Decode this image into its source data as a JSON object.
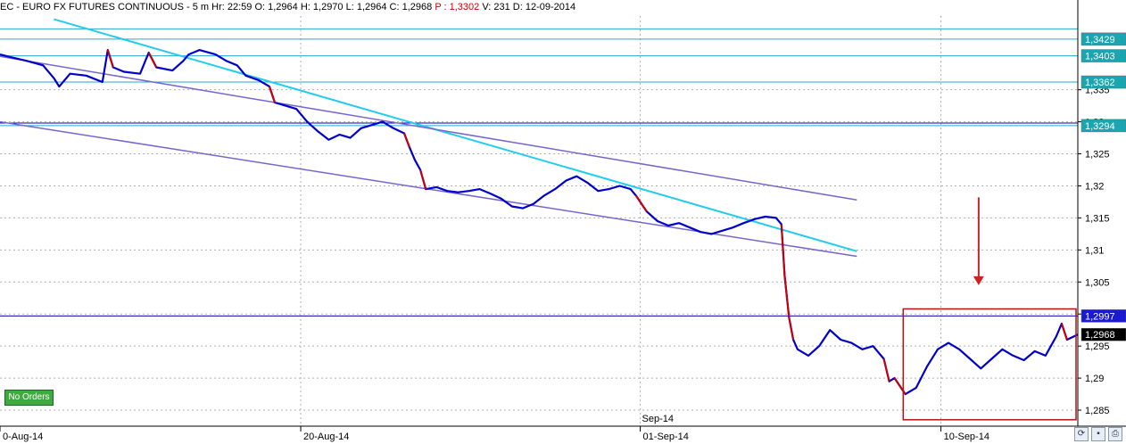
{
  "header": {
    "symbol": "EC - EURO FX FUTURES CONTINUOUS",
    "interval": "5 m",
    "hr": "Hr: 22:59",
    "open": "O: 1,2964",
    "high": "H: 1,2970",
    "low": "L: 1,2964",
    "close": "C: 1,2968",
    "p": "P : 1,3302",
    "volume": "V: 231",
    "date": "D: 12-09-2014"
  },
  "no_orders_label": "No Orders",
  "colors": {
    "price": "#0000cc",
    "price_down": "#cc0000",
    "trendline": "#22ccee",
    "channel": "#7766cc",
    "resistance_cyan": "#22aacc",
    "support_blue": "#0000bb",
    "box": "#bb1111",
    "arrow": "#cc2222",
    "grid": "#b0b0b0",
    "label_teal": "#1aa5b0",
    "label_blue": "#1a1ad0",
    "label_black": "#000000"
  },
  "chart_data": {
    "type": "line",
    "y_ticks": [
      "1,335",
      "1,33",
      "1,325",
      "1,32",
      "1,315",
      "1,31",
      "1,305",
      "1,3",
      "1,295",
      "1,29",
      "1,285"
    ],
    "x_ticks": [
      "0-Aug-14",
      "20-Aug-14",
      "01-Sep-14",
      "10-Sep-14"
    ],
    "x_marker": "Sep-14",
    "ylim": [
      1.2825,
      1.3465
    ],
    "price_labels": [
      {
        "text": "1,3429",
        "value": 1.3429,
        "kind": "teal"
      },
      {
        "text": "1,3403",
        "value": 1.3403,
        "kind": "teal"
      },
      {
        "text": "1,3362",
        "value": 1.3362,
        "kind": "teal"
      },
      {
        "text": "1,3294",
        "value": 1.3294,
        "kind": "teal"
      },
      {
        "text": "1,2997",
        "value": 1.2997,
        "kind": "blue"
      },
      {
        "text": "1,2968",
        "value": 1.2968,
        "kind": "black"
      }
    ],
    "series": [
      {
        "points": [
          [
            0,
            1.3405
          ],
          [
            0.012,
            1.34
          ],
          [
            0.025,
            1.3395
          ],
          [
            0.04,
            1.3388
          ],
          [
            0.05,
            1.3368
          ],
          [
            0.055,
            1.3355
          ],
          [
            0.065,
            1.3375
          ],
          [
            0.08,
            1.3372
          ],
          [
            0.095,
            1.3362
          ],
          [
            0.1,
            1.3412
          ],
          [
            0.105,
            1.3385
          ],
          [
            0.115,
            1.3378
          ],
          [
            0.13,
            1.3375
          ],
          [
            0.138,
            1.3408
          ],
          [
            0.145,
            1.3385
          ],
          [
            0.16,
            1.338
          ],
          [
            0.17,
            1.3395
          ],
          [
            0.175,
            1.3405
          ],
          [
            0.185,
            1.3412
          ],
          [
            0.2,
            1.3405
          ],
          [
            0.21,
            1.3395
          ],
          [
            0.22,
            1.3388
          ],
          [
            0.228,
            1.3372
          ],
          [
            0.24,
            1.3365
          ],
          [
            0.25,
            1.3355
          ],
          [
            0.255,
            1.333
          ],
          [
            0.265,
            1.3325
          ],
          [
            0.275,
            1.332
          ],
          [
            0.285,
            1.33
          ],
          [
            0.295,
            1.3285
          ],
          [
            0.305,
            1.3272
          ],
          [
            0.315,
            1.328
          ],
          [
            0.325,
            1.3275
          ],
          [
            0.335,
            1.329
          ],
          [
            0.345,
            1.3295
          ],
          [
            0.355,
            1.33
          ],
          [
            0.365,
            1.329
          ],
          [
            0.375,
            1.3282
          ],
          [
            0.38,
            1.326
          ],
          [
            0.385,
            1.324
          ],
          [
            0.39,
            1.3225
          ],
          [
            0.395,
            1.3195
          ],
          [
            0.405,
            1.3198
          ],
          [
            0.415,
            1.3192
          ],
          [
            0.425,
            1.319
          ],
          [
            0.435,
            1.3192
          ],
          [
            0.445,
            1.3195
          ],
          [
            0.455,
            1.3188
          ],
          [
            0.465,
            1.318
          ],
          [
            0.475,
            1.3168
          ],
          [
            0.485,
            1.3165
          ],
          [
            0.495,
            1.3172
          ],
          [
            0.505,
            1.3185
          ],
          [
            0.515,
            1.3195
          ],
          [
            0.525,
            1.3208
          ],
          [
            0.535,
            1.3215
          ],
          [
            0.545,
            1.3205
          ],
          [
            0.555,
            1.3192
          ],
          [
            0.565,
            1.3195
          ],
          [
            0.575,
            1.32
          ],
          [
            0.585,
            1.3195
          ],
          [
            0.59,
            1.3185
          ],
          [
            0.6,
            1.316
          ],
          [
            0.61,
            1.3145
          ],
          [
            0.62,
            1.3138
          ],
          [
            0.63,
            1.3142
          ],
          [
            0.64,
            1.3135
          ],
          [
            0.65,
            1.3128
          ],
          [
            0.66,
            1.3125
          ],
          [
            0.67,
            1.313
          ],
          [
            0.68,
            1.3135
          ],
          [
            0.69,
            1.3142
          ],
          [
            0.7,
            1.3148
          ],
          [
            0.71,
            1.3152
          ],
          [
            0.72,
            1.315
          ],
          [
            0.725,
            1.314
          ],
          [
            0.728,
            1.306
          ],
          [
            0.732,
            1.2995
          ],
          [
            0.736,
            1.296
          ],
          [
            0.74,
            1.2945
          ],
          [
            0.75,
            1.2935
          ],
          [
            0.76,
            1.295
          ],
          [
            0.77,
            1.2975
          ],
          [
            0.78,
            1.296
          ],
          [
            0.79,
            1.2955
          ],
          [
            0.8,
            1.2945
          ],
          [
            0.81,
            1.295
          ],
          [
            0.82,
            1.293
          ],
          [
            0.825,
            1.2895
          ],
          [
            0.83,
            1.29
          ],
          [
            0.84,
            1.2875
          ],
          [
            0.85,
            1.2885
          ],
          [
            0.86,
            1.2918
          ],
          [
            0.87,
            1.2945
          ],
          [
            0.88,
            1.2955
          ],
          [
            0.89,
            1.2945
          ],
          [
            0.9,
            1.293
          ],
          [
            0.91,
            1.2915
          ],
          [
            0.92,
            1.293
          ],
          [
            0.93,
            1.2945
          ],
          [
            0.94,
            1.2935
          ],
          [
            0.95,
            1.2928
          ],
          [
            0.96,
            1.2942
          ],
          [
            0.97,
            1.2935
          ],
          [
            0.98,
            1.2965
          ],
          [
            0.985,
            1.2985
          ],
          [
            0.99,
            1.296
          ],
          [
            1.0,
            1.2968
          ]
        ]
      }
    ],
    "horizontal_lines": [
      {
        "value": 1.3445,
        "kind": "teal"
      },
      {
        "value": 1.3429,
        "kind": "teal"
      },
      {
        "value": 1.3403,
        "kind": "teal"
      },
      {
        "value": 1.3362,
        "kind": "teal"
      },
      {
        "value": 1.3298,
        "kind": "blue"
      },
      {
        "value": 1.3294,
        "kind": "teal"
      },
      {
        "value": 1.2997,
        "kind": "blue"
      }
    ],
    "trendlines": [
      {
        "kind": "trendline",
        "from": [
          0.05,
          1.346
        ],
        "to": [
          0.795,
          1.3098
        ]
      },
      {
        "kind": "channel",
        "from": [
          0.0,
          1.3402
        ],
        "to": [
          0.795,
          1.3178
        ]
      },
      {
        "kind": "channel",
        "from": [
          0.0,
          1.33
        ],
        "to": [
          0.795,
          1.309
        ]
      }
    ],
    "highlight_box": {
      "x_from": 0.838,
      "x_to": 1.0,
      "y_from": 1.2835,
      "y_to": 1.3008
    },
    "arrow": {
      "x": 0.908,
      "y_from": 1.3182,
      "y_to": 1.3045
    }
  }
}
